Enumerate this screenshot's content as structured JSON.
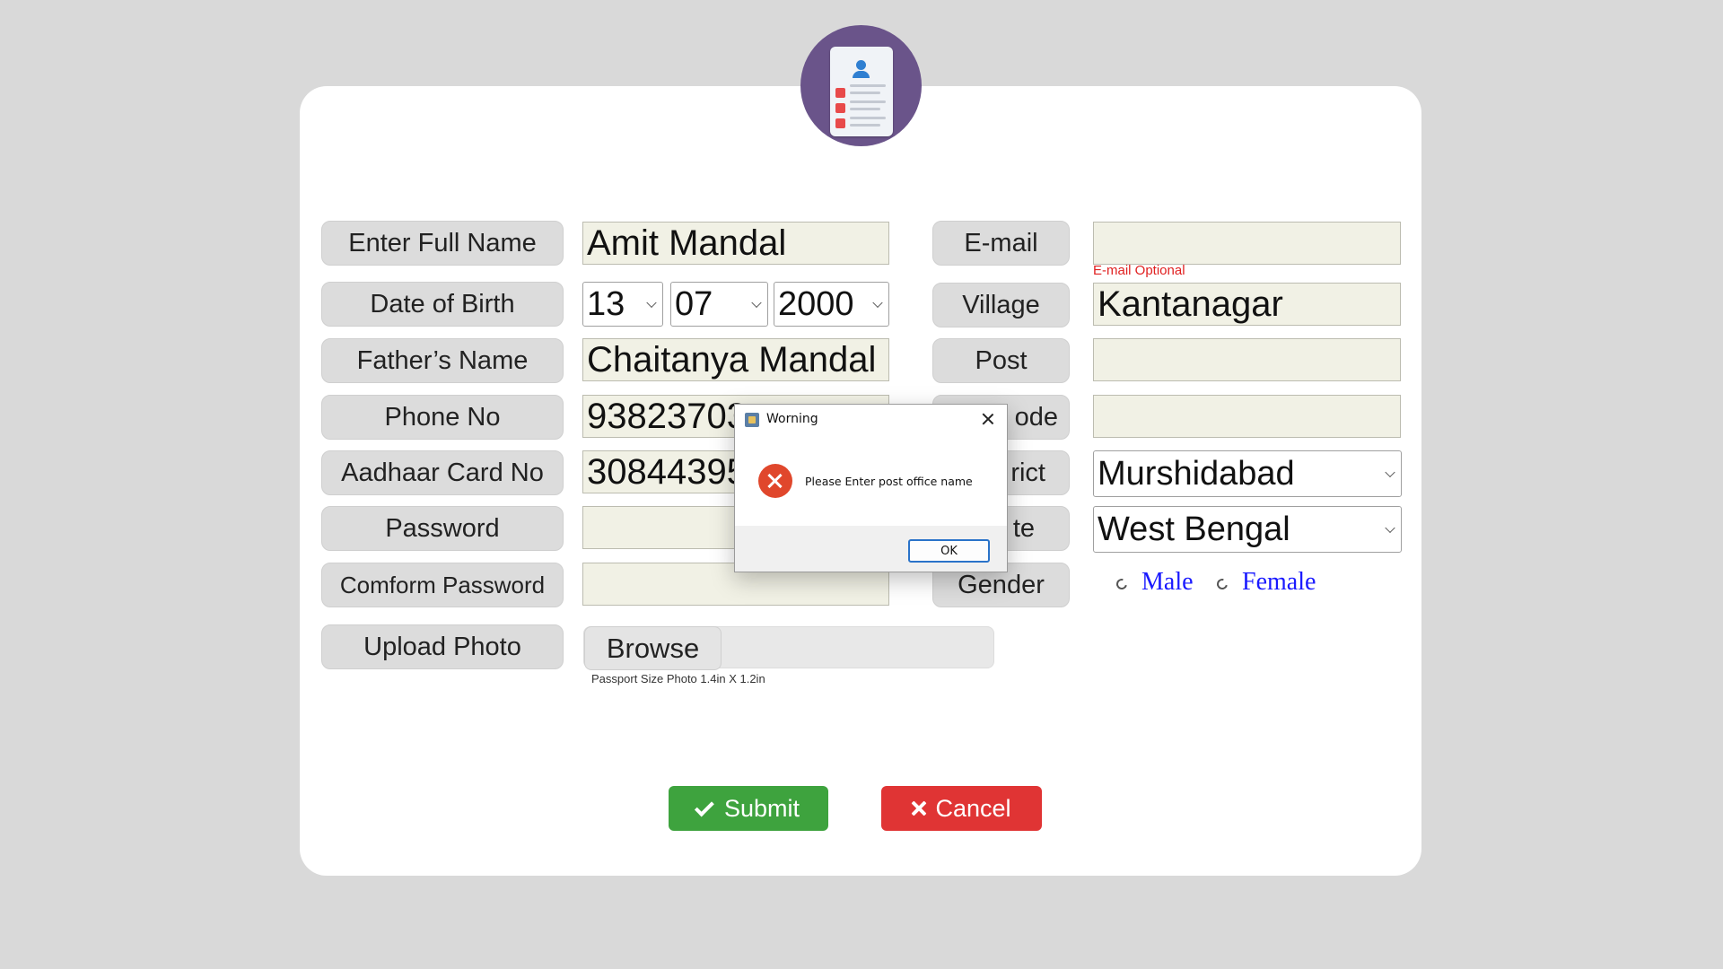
{
  "form": {
    "labels": {
      "full_name": "Enter Full Name",
      "dob": "Date of Birth",
      "father": "Father’s Name",
      "phone": "Phone No",
      "aadhaar": "Aadhaar Card No",
      "password": "Password",
      "confirm_password": "Comform Password",
      "upload_photo": "Upload Photo",
      "email": "E-mail",
      "village": "Village",
      "post": "Post",
      "pincode_partial": "ode",
      "district_partial": "rict",
      "state_partial": "te",
      "gender": "Gender"
    },
    "values": {
      "full_name": "Amit Mandal",
      "dob_day": "13",
      "dob_month": "07",
      "dob_year": "2000",
      "father": "Chaitanya Mandal",
      "phone_visible": "93823703",
      "aadhaar_visible": "30844395",
      "password": "",
      "confirm_password": "",
      "email": "",
      "village": "Kantanagar",
      "post": "",
      "pincode": "",
      "district": "Murshidabad",
      "state": "West Bengal"
    },
    "hints": {
      "email_optional": "E-mail Optional",
      "photo_size": "Passport Size Photo 1.4in X 1.2in"
    },
    "gender_options": [
      "Male",
      "Female"
    ],
    "browse_label": "Browse",
    "submit_label": "Submit",
    "cancel_label": "Cancel"
  },
  "dialog": {
    "title": "Worning",
    "message": "Please Enter post office name",
    "ok_label": "OK"
  },
  "colors": {
    "submit": "#3ea33e",
    "cancel": "#e03434",
    "radio_label": "#1a1aff",
    "hint_red": "#e02020"
  }
}
